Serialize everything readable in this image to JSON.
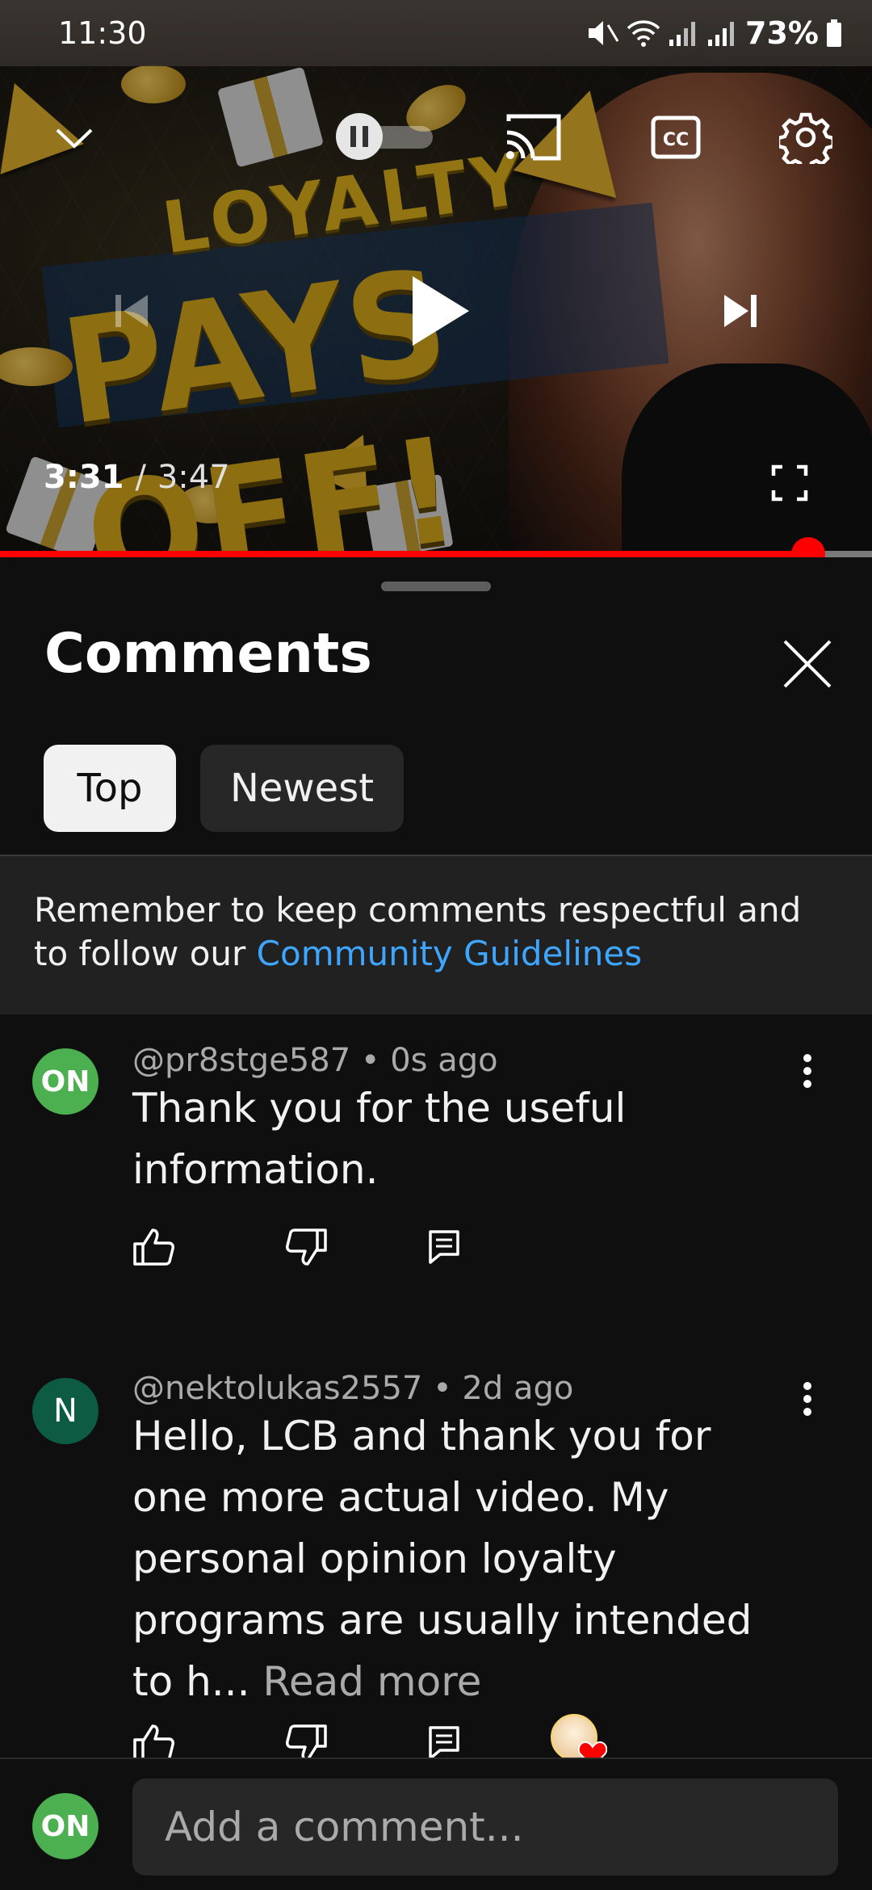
{
  "status_bar": {
    "time": "11:30",
    "battery": "73%"
  },
  "player": {
    "thumbnail_text_line1": "LOYALTY",
    "thumbnail_text_line2": "PAYS OFF!",
    "current_time": "3:31",
    "separator": "/",
    "duration": "3:47",
    "progress_fraction": 0.927,
    "cc_label": "CC"
  },
  "comments_panel": {
    "title": "Comments",
    "sort_chips": [
      {
        "label": "Top",
        "selected": true
      },
      {
        "label": "Newest",
        "selected": false
      }
    ],
    "guidelines_text": "Remember to keep comments respectful and to follow our ",
    "guidelines_link": "Community Guidelines",
    "comments": [
      {
        "avatar_text": "ON",
        "avatar_color": "#4caf50",
        "author": "@pr8stge587",
        "age": "0s ago",
        "text": "Thank you for the useful information.",
        "read_more": ""
      },
      {
        "avatar_text": "N",
        "avatar_color": "#0d5b43",
        "author": "@nektolukas2557",
        "age": "2d ago",
        "text": "Hello, LCB and thank you for one more actual video. My personal opinion loyalty programs are usually intended to h...",
        "read_more": "Read more"
      }
    ],
    "meta_separator": " • "
  },
  "composer": {
    "avatar_text": "ON",
    "placeholder": "Add a comment..."
  },
  "colors": {
    "accent_red": "#ff0000",
    "link_blue": "#3ea6ff",
    "background": "#0f0f0f"
  },
  "icons": [
    "chevron-down-icon",
    "pause-icon",
    "cast-icon",
    "cc-icon",
    "settings-gear-icon",
    "previous-icon",
    "play-icon",
    "next-icon",
    "fullscreen-icon",
    "close-icon",
    "like-icon",
    "dislike-icon",
    "reply-icon",
    "more-vert-icon",
    "creator-heart-icon"
  ]
}
